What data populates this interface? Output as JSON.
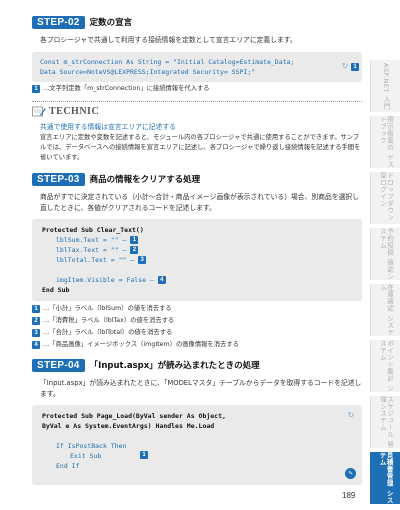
{
  "sidebar": [
    {
      "label": "ASP.NET 入門"
    },
    {
      "label": "掲示板風の ゲストブック"
    },
    {
      "label": "ドロップダウン 型ログイン"
    },
    {
      "label": "予約投稿 確認システム"
    },
    {
      "label": "在庫確認 システム"
    },
    {
      "label": "ポイント集計 システム"
    },
    {
      "label": "スケジュール 管理システム"
    },
    {
      "label": "見積書管理 システム"
    }
  ],
  "step02": {
    "badge": "STEP-02",
    "title": "定数の宣言",
    "body": "各プロシージャで共通して利用する接続情報を定数として宣言エリアに定義します。",
    "code_line1": "Const m_strConnection As String = \"Initial Catalog=Estimate_Data;",
    "code_line2": "Data Source=NoteVS@LEXPRESS;Integrated Security= SSPI;\"",
    "code_marker": "1",
    "note_num": "1",
    "note_text": "…文字列定数「m_strConnection」に接続情報を代入する"
  },
  "technic": {
    "label": "TECHNIC",
    "subtitle": "共通で使用する情報は宣言エリアに記述する",
    "body": "宣言エリアに定数や変数を記述すると、モジュール内の各プロシージャで共通に使用することができます。サンプルでは、データベースへの接続情報を宣言エリアに記述し、各プロシージャで繰り返し接続情報を記述する手間を省いています。"
  },
  "step03": {
    "badge": "STEP-03",
    "title": "商品の情報をクリアする処理",
    "body": "商品がすでに決定されている（小計～合計・商品イメージ画像が表示されている）場合、別商品を選択し直したときに、各値がクリアされるコードを記述します。",
    "code": [
      {
        "text": "Protected Sub Clear_Text()",
        "style": "black",
        "indent": 0,
        "num": ""
      },
      {
        "text": "lblSum.Text = \"\"",
        "style": "blue",
        "indent": 1,
        "num": "1"
      },
      {
        "text": "lblTax.Text = \"\"",
        "style": "blue",
        "indent": 1,
        "num": "2"
      },
      {
        "text": "lblTotal.Text = \"\"",
        "style": "blue",
        "indent": 1,
        "num": "3"
      },
      {
        "text": "",
        "style": "blue",
        "indent": 1,
        "num": ""
      },
      {
        "text": "imgItem.Visible = False",
        "style": "blue",
        "indent": 1,
        "num": "4"
      },
      {
        "text": "End Sub",
        "style": "black",
        "indent": 0,
        "num": ""
      }
    ],
    "notes": [
      {
        "num": "1",
        "text": "…「小計」ラベル（lblSum）の値を消去する"
      },
      {
        "num": "2",
        "text": "…「消費税」ラベル（lblTax）の値を消去する"
      },
      {
        "num": "3",
        "text": "…「合計」ラベル（lblTotal）の値を消去する"
      },
      {
        "num": "4",
        "text": "…「商品画像」イメージボックス（imgItem）の画像情報を消去する"
      }
    ]
  },
  "step04": {
    "badge": "STEP-04",
    "title": "「Input.aspx」が読み込まれたときの処理",
    "body": "「Input.aspx」が読み込まれたときに、「MODELマスタ」テーブルからデータを取得するコードを記述します。",
    "code": [
      {
        "text": "Protected Sub Page_Load(ByVal sender As Object,",
        "style": "black",
        "indent": 0
      },
      {
        "text": "ByVal e As System.EventArgs) Handles Me.Load",
        "style": "black",
        "indent": 0
      },
      {
        "text": "",
        "style": "black",
        "indent": 0
      },
      {
        "text": "If IsPostBack Then",
        "style": "blue",
        "indent": 1
      },
      {
        "text": "Exit Sub",
        "style": "blue",
        "indent": 2
      },
      {
        "text": "End If",
        "style": "blue",
        "indent": 1
      }
    ],
    "code_marker": "1"
  },
  "page_number": "189"
}
